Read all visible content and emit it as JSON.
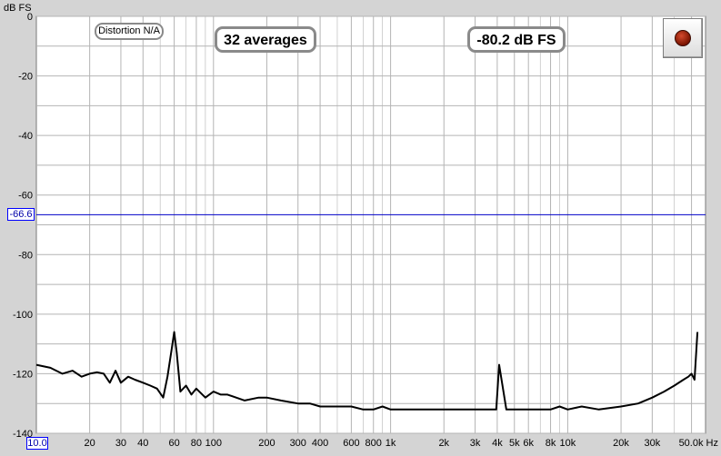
{
  "chart_data": {
    "type": "line",
    "ylabel": "dB FS",
    "x_unit": "Hz",
    "x_scale": "log",
    "xlim": [
      10,
      60000
    ],
    "ylim": [
      -140,
      0
    ],
    "grid": true,
    "y_ticks": [
      0,
      -20,
      -40,
      -60,
      -80,
      -100,
      -120,
      -140
    ],
    "y_tick_labels": [
      "0",
      "-20",
      "-40",
      "-60",
      "-80",
      "-100",
      "-120",
      "-140"
    ],
    "x_ticks": [
      20,
      30,
      40,
      60,
      80,
      100,
      200,
      300,
      400,
      600,
      800,
      1000,
      2000,
      3000,
      4000,
      5000,
      6000,
      8000,
      10000,
      20000,
      30000,
      50000
    ],
    "x_tick_labels": [
      "20",
      "30",
      "40",
      "60",
      "80",
      "100",
      "200",
      "300",
      "400",
      "600",
      "800",
      "1k",
      "2k",
      "3k",
      "4k",
      "5k",
      "6k",
      "8k",
      "10k",
      "20k",
      "30k",
      "50.0k Hz"
    ],
    "x_min_label": "10.0",
    "reference_level": -66.6,
    "reference_label": "-66.6",
    "series": [
      {
        "x": [
          10,
          12,
          14,
          16,
          18,
          20,
          22,
          24,
          26,
          28,
          30,
          33,
          36,
          40,
          44,
          48,
          52,
          55,
          58,
          60,
          62,
          65,
          70,
          75,
          80,
          90,
          100,
          110,
          120,
          150,
          180,
          200,
          240,
          300,
          350,
          400,
          480,
          600,
          700,
          800,
          900,
          1000,
          1200,
          1500,
          2000,
          2500,
          3000,
          3500,
          3950,
          4100,
          4500,
          5000,
          6000,
          7000,
          8000,
          9000,
          10000,
          12000,
          15000,
          20000,
          25000,
          30000,
          35000,
          40000,
          45000,
          48000,
          50000,
          52000,
          54000
        ],
        "y": [
          -117,
          -118,
          -120,
          -119,
          -121,
          -120,
          -119.5,
          -120,
          -123,
          -119,
          -123,
          -121,
          -122,
          -123,
          -124,
          -125,
          -128,
          -121,
          -112,
          -106,
          -113,
          -126,
          -124,
          -127,
          -125,
          -128,
          -126,
          -127,
          -127,
          -129,
          -128,
          -128,
          -129,
          -130,
          -130,
          -131,
          -131,
          -131,
          -132,
          -132,
          -131,
          -132,
          -132,
          -132,
          -132,
          -132,
          -132,
          -132,
          -132,
          -117,
          -132,
          -132,
          -132,
          -132,
          -132,
          -131,
          -132,
          -131,
          -132,
          -131,
          -130,
          -128,
          -126,
          -124,
          -122,
          -121,
          -120,
          -122,
          -106
        ]
      }
    ],
    "series_color": "#000000"
  },
  "annotations": {
    "distortion": "Distortion N/A",
    "averages": "32 averages",
    "level": "-80.2 dB FS"
  },
  "colors": {
    "background": "#d4d4d4",
    "plot_area": "#ffffff",
    "grid": "#b4b4b4",
    "reference_line": "#0000c8",
    "record_button": "#8b1a00"
  },
  "icons": {
    "record": "record-dot-icon"
  }
}
